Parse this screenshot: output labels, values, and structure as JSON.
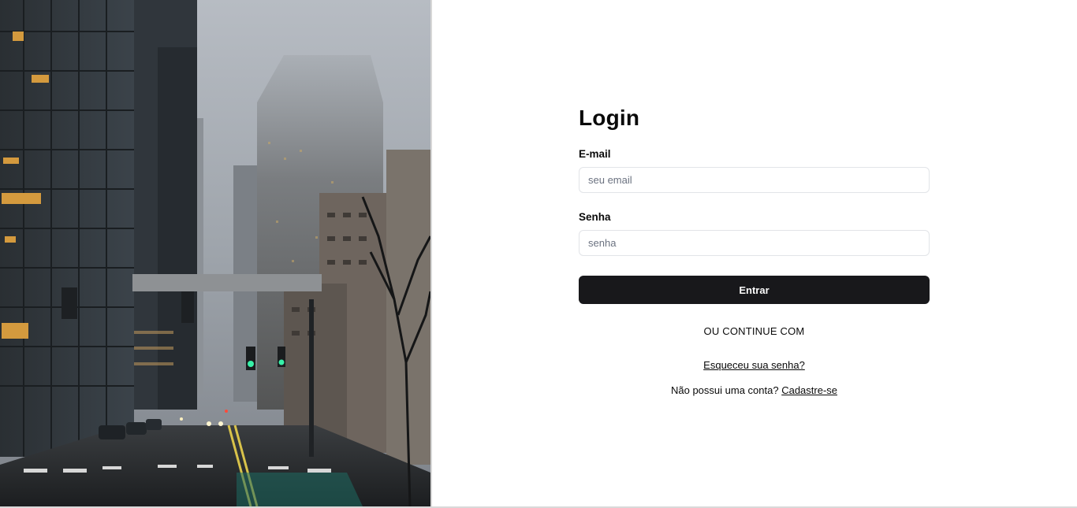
{
  "image": {
    "description_icon": "city-street-photo"
  },
  "form": {
    "title": "Login",
    "email_label": "E-mail",
    "email_placeholder": "seu email",
    "email_value": "",
    "password_label": "Senha",
    "password_placeholder": "senha",
    "password_value": "",
    "submit_label": "Entrar",
    "alt_login_text": "OU CONTINUE COM",
    "forgot_password": "Esqueceu sua senha?",
    "no_account_text": "Não possui uma conta?",
    "signup_link": "Cadastre-se"
  },
  "colors": {
    "button_bg": "#18181b",
    "button_text": "#fafafa",
    "input_border": "#e2e4e8"
  }
}
